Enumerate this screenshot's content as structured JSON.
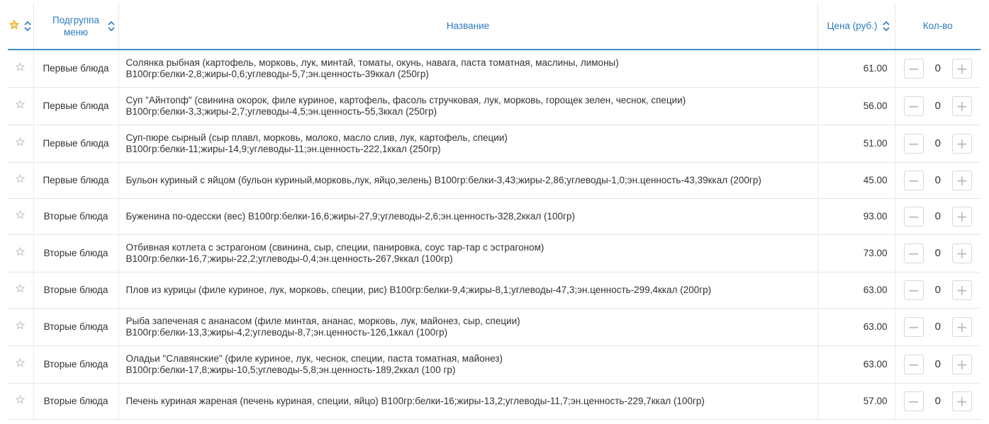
{
  "header": {
    "fav_icon": "star-outline-icon",
    "group_label": "Подгруппа меню",
    "name_label": "Название",
    "price_label": "Цена (руб.)",
    "qty_label": "Кол-во"
  },
  "colors": {
    "accent": "#2a7bbf",
    "border": "#3f8fcf"
  },
  "rows": [
    {
      "group": "Первые блюда",
      "name1": "Солянка рыбная (картофель, морковь, лук, минтай, томаты, окунь, навага, паста томатная, маслины, лимоны)",
      "name2": "В100гр:белки-2,8;жиры-0,6;углеводы-5,7;эн.ценность-39ккал (250гр)",
      "price": "61.00",
      "qty": "0"
    },
    {
      "group": "Первые блюда",
      "name1": "Суп \"Айнтопф\" (свинина окорок, филе куриное, картофель, фасоль стручковая, лук, морковь, горощек зелен, чеснок, специи)",
      "name2": "В100гр:белки-3,3;жиры-2,7;углеводы-4,5;эн.ценность-55,3ккал (250гр)",
      "price": "56.00",
      "qty": "0"
    },
    {
      "group": "Первые блюда",
      "name1": "Суп-пюре сырный (сыр плавл, морковь, молоко, масло слив, лук, картофель, специи)",
      "name2": "В100гр:белки-11;жиры-14,9;углеводы-11;эн.ценность-222,1ккал (250гр)",
      "price": "51.00",
      "qty": "0"
    },
    {
      "group": "Первые блюда",
      "name1": "Бульон куриный с яйцом (бульон куриный,морковь,лук, яйцо,зелень) В100гр:белки-3,43;жиры-2,86;углеводы-1,0;эн.ценность-43,39ккал (200гр)",
      "name2": "",
      "price": "45.00",
      "qty": "0"
    },
    {
      "group": "Вторые блюда",
      "name1": "Буженина по-одесски (вес) В100гр:белки-16,6;жиры-27,9;углеводы-2,6;эн.ценность-328,2ккал (100гр)",
      "name2": "",
      "price": "93.00",
      "qty": "0"
    },
    {
      "group": "Вторые блюда",
      "name1": "Отбивная котлета с эстрагоном (свинина, сыр, специи, панировка, соус тар-тар с эстрагоном)",
      "name2": "В100гр:белки-16,7;жиры-22,2;углеводы-0,4;эн.ценность-267,9ккал (100гр)",
      "price": "73.00",
      "qty": "0"
    },
    {
      "group": "Вторые блюда",
      "name1": "Плов из курицы (филе куриное, лук, морковь, специи, рис) В100гр:белки-9,4;жиры-8,1;углеводы-47,3;эн.ценность-299,4ккал (200гр)",
      "name2": "",
      "price": "63.00",
      "qty": "0"
    },
    {
      "group": "Вторые блюда",
      "name1": "Рыба запеченая с ананасом (филе минтая, ананас, морковь, лук, майонез, сыр, специи)",
      "name2": "В100гр:белки-13,3;жиры-4,2;углеводы-8,7;эн.ценность-126,1ккал (100гр)",
      "price": "63.00",
      "qty": "0"
    },
    {
      "group": "Вторые блюда",
      "name1": "Оладьи \"Славянские\" (филе куриное, лук, чеснок, специи, паста томатная, майонез)",
      "name2": "В100гр:белки-17,8;жиры-10,5;углеводы-5,8;эн.ценность-189,2ккал (100 гр)",
      "price": "63.00",
      "qty": "0"
    },
    {
      "group": "Вторые блюда",
      "name1": "Печень куриная жареная (печень куриная, специи, яйцо) В100гр:белки-16;жиры-13,2;углеводы-11,7;эн.ценность-229,7ккал (100гр)",
      "name2": "",
      "price": "57.00",
      "qty": "0"
    }
  ]
}
